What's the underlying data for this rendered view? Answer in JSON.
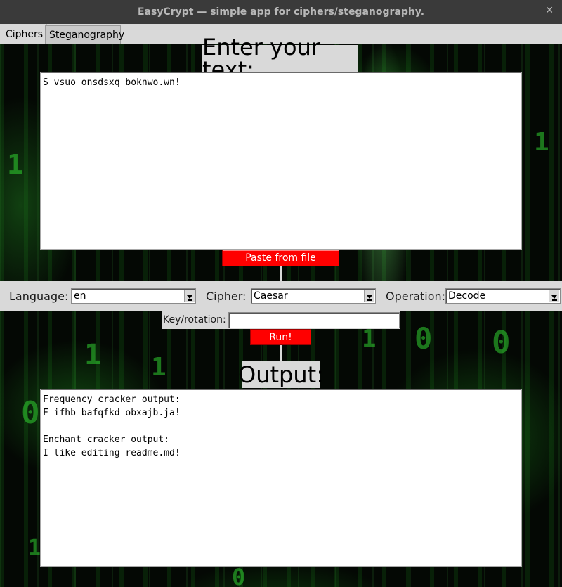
{
  "window": {
    "title": "EasyCrypt — simple app for ciphers/steganography.",
    "close_icon": "✕"
  },
  "tabs": [
    {
      "label": "Ciphers",
      "active": true
    },
    {
      "label": "Steganography",
      "active": false
    }
  ],
  "input": {
    "heading": "Enter your text:",
    "value": "S vsuo onsdsxq boknwo.wn!",
    "paste_button": "Paste from file"
  },
  "options": {
    "language_label": "Language:",
    "language_value": "en",
    "cipher_label": "Cipher:",
    "cipher_value": "Caesar",
    "operation_label": "Operation:",
    "operation_value": "Decode",
    "key_label": "Key/rotation:",
    "key_value": "",
    "run_button": "Run!"
  },
  "output": {
    "heading": "Output:",
    "value": "Frequency cracker output:\nF ifhb bafqfkd obxajb.ja!\n\nEnchant cracker output:\nI like editing readme.md!"
  },
  "colors": {
    "accent_button": "#ff0000",
    "panel": "#d9d9d9",
    "background": "#040804"
  }
}
